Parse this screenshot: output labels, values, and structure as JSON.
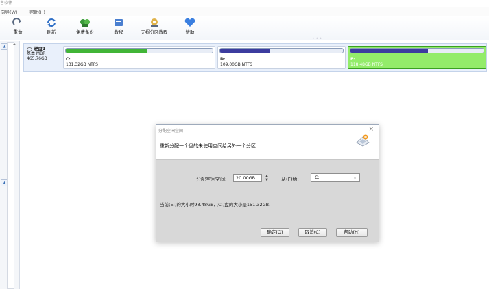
{
  "app": {
    "title": "害软件"
  },
  "menu": {
    "items": [
      "向导(W)",
      "帮助(H)"
    ]
  },
  "toolbar": {
    "buttons": [
      "重做",
      "刷新",
      "免费备份",
      "教程",
      "无损分区教程",
      "赞助"
    ]
  },
  "disk": {
    "name": "硬盘1",
    "type": "基本 MBR",
    "size": "465.76GB",
    "partitions": [
      {
        "name": "C:",
        "info": "131.32GB NTFS",
        "used": 0.55,
        "color": "#41b537"
      },
      {
        "name": "D:",
        "info": "109.00GB NTFS",
        "used": 0.4,
        "color": "#3c3c9f"
      },
      {
        "name": "E:",
        "info": "118.48GB NTFS",
        "used": 0.58,
        "color": "#3c3c9f",
        "selected": true
      }
    ]
  },
  "dialog": {
    "title": "分配空闲空间",
    "close": "×",
    "heading": "重新分配一个盘的未使用空间给另外一个分区.",
    "alloc_label": "分配空闲空间:",
    "alloc_value": "20.00GB",
    "from_label": "从(F)给:",
    "from_value": "C:",
    "summary": "当前(E:)的大小时98.48GB, (C:)盘的大小是151.32GB.",
    "buttons": {
      "ok": "确定(O)",
      "cancel": "取消(C)",
      "help": "帮助(H)"
    }
  },
  "colors": {
    "accent": "#3c3c9f",
    "used_green": "#41b537",
    "selected_bg": "#93ec6a"
  }
}
